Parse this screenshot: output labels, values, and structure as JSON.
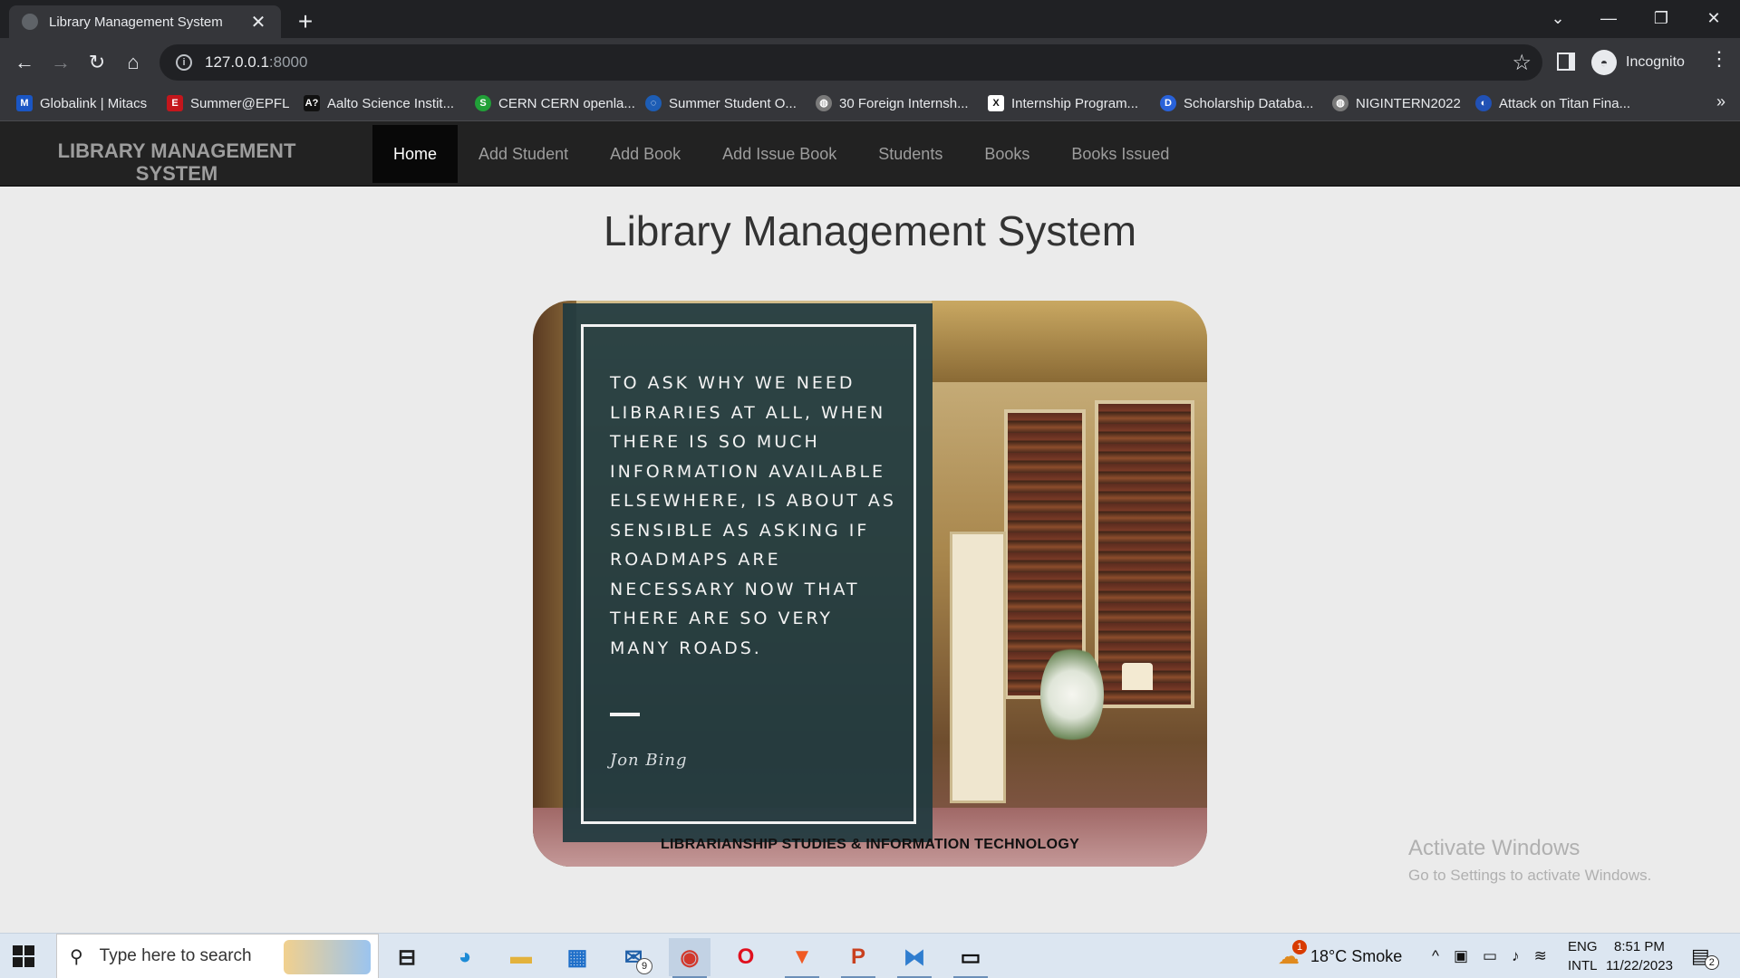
{
  "browser": {
    "tab_title": "Library Management System",
    "tab_close": "✕",
    "new_tab": "+",
    "window_controls": [
      "⌄",
      "—",
      "❐",
      "✕"
    ],
    "url_host": "127.0.0.1",
    "url_port": ":8000",
    "profile_label": "Incognito",
    "bookmarks": [
      {
        "label": "Globalink | Mitacs",
        "icon": "M",
        "color": "#1a56c4"
      },
      {
        "label": "Summer@EPFL",
        "icon": "E",
        "color": "#c4161c"
      },
      {
        "label": "Aalto Science Instit...",
        "icon": "A?",
        "color": "#111111"
      },
      {
        "label": "CERN CERN openla...",
        "icon": "S",
        "color": "#21a038"
      },
      {
        "label": "Summer Student O...",
        "icon": "◌",
        "color": "#1d5db5"
      },
      {
        "label": "30 Foreign Internsh...",
        "icon": "◍",
        "color": "#7a7a7a"
      },
      {
        "label": "Internship Program...",
        "icon": "X",
        "color": "#ffffff"
      },
      {
        "label": "Scholarship Databa...",
        "icon": "D",
        "color": "#2962d9"
      },
      {
        "label": "NIGINTERN2022",
        "icon": "◍",
        "color": "#7a7a7a"
      },
      {
        "label": "Attack on Titan Fina...",
        "icon": "◐",
        "color": "#2151b5"
      }
    ],
    "bookmarks_more": "»"
  },
  "site": {
    "brand": "LIBRARY MANAGEMENT SYSTEM",
    "nav": [
      "Home",
      "Add Student",
      "Add Book",
      "Add Issue Book",
      "Students",
      "Books",
      "Books Issued"
    ],
    "active_nav": "Home",
    "heading": "Library Management System"
  },
  "hero": {
    "quote": "TO ASK WHY WE NEED LIBRARIES AT ALL, WHEN THERE IS SO MUCH INFORMATION AVAILABLE ELSEWHERE, IS ABOUT AS SENSIBLE AS ASKING IF ROADMAPS ARE NECESSARY NOW THAT THERE ARE SO VERY MANY ROADS.",
    "author": "Jon Bing",
    "caption": "LIBRARIANSHIP STUDIES & INFORMATION TECHNOLOGY"
  },
  "watermark": {
    "line1": "Activate Windows",
    "line2": "Go to Settings to activate Windows."
  },
  "taskbar": {
    "search_placeholder": "Type here to search",
    "mail_badge": "9",
    "weather": "18°C  Smoke",
    "weather_badge": "1",
    "lang_top": "ENG",
    "lang_bottom": "INTL",
    "time": "8:51 PM",
    "date": "11/22/2023",
    "notification_count": "2"
  }
}
